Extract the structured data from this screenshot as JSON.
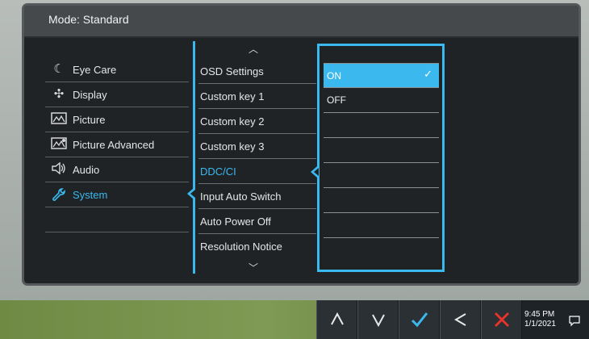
{
  "header": {
    "mode": "Mode: Standard"
  },
  "categories": [
    {
      "label": "Eye Care",
      "icon": "eye-care-icon"
    },
    {
      "label": "Display",
      "icon": "display-icon"
    },
    {
      "label": "Picture",
      "icon": "picture-icon"
    },
    {
      "label": "Picture Advanced",
      "icon": "picture-advanced-icon"
    },
    {
      "label": "Audio",
      "icon": "audio-icon"
    },
    {
      "label": "System",
      "icon": "system-wrench-icon",
      "active": true
    }
  ],
  "options": [
    {
      "label": "OSD Settings"
    },
    {
      "label": "Custom key 1"
    },
    {
      "label": "Custom key 2"
    },
    {
      "label": "Custom key 3"
    },
    {
      "label": "DDC/CI",
      "active": true
    },
    {
      "label": "Input Auto Switch"
    },
    {
      "label": "Auto Power Off"
    },
    {
      "label": "Resolution Notice"
    }
  ],
  "values": [
    {
      "label": "ON",
      "selected": true,
      "check": "✓"
    },
    {
      "label": "OFF"
    }
  ],
  "hw_keys": [
    {
      "name": "up-key",
      "icon": "chevron-up-icon"
    },
    {
      "name": "down-key",
      "icon": "chevron-down-icon"
    },
    {
      "name": "confirm-key",
      "icon": "checkmark-icon"
    },
    {
      "name": "back-key",
      "icon": "chevron-left-icon"
    },
    {
      "name": "exit-key",
      "icon": "close-icon"
    }
  ],
  "taskbar": {
    "time": "9:45 PM",
    "date": "1/1/2021"
  },
  "colors": {
    "accent": "#3bb8ee",
    "osd_bg": "#1f2326",
    "header_bg": "#45494c",
    "exit_red": "#e8332a"
  }
}
